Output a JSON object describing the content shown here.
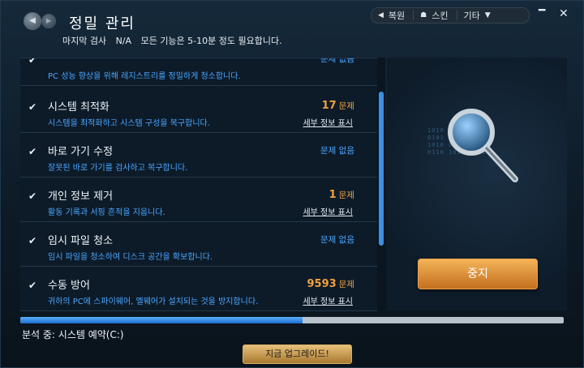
{
  "header": {
    "title": "정밀 관리",
    "last_scan_label": "마지막 검사",
    "last_scan_value": "N/A",
    "note": "모든 기능은 5-10분 정도 필요합니다."
  },
  "topbar": {
    "restore_label": "복원",
    "skin_label": "스킨",
    "etc_label": "기타"
  },
  "colors": {
    "accent_blue": "#4aa7ff",
    "issue_orange": "#f2a13c",
    "stop_button": "#e0912f"
  },
  "list": {
    "items": [
      {
        "title": "",
        "desc": "PC 성능 향상을 위해 레지스트리를 정밀하게 청소합니다.",
        "status_count": "",
        "status_text": "문제 없음",
        "detail": "",
        "checked": true
      },
      {
        "title": "시스템 최적화",
        "desc": "시스템을 최적화하고 시스템 구성을 복구합니다.",
        "status_count": "17",
        "status_text": "문제",
        "detail": "세부 정보 표시",
        "checked": true
      },
      {
        "title": "바로 가기 수정",
        "desc": "잘못된 바로 가기를 검사하고 복구합니다.",
        "status_count": "",
        "status_text": "문제 없음",
        "detail": "",
        "checked": true
      },
      {
        "title": "개인 정보 제거",
        "desc": "활동 기록과 서핑 흔적을 지웁니다.",
        "status_count": "1",
        "status_text": "문제",
        "detail": "세부 정보 표시",
        "checked": true
      },
      {
        "title": "임시 파일 청소",
        "desc": "임시 파일을 청소하여 디스크 공간을 확보합니다.",
        "status_count": "",
        "status_text": "문제 없음",
        "detail": "",
        "checked": true
      },
      {
        "title": "수동 방어",
        "desc": "귀하의 PC에 스파이웨어, 멜웨어가 설치되는 것을 방지합니다.",
        "status_count": "9593",
        "status_text": "문제",
        "detail": "세부 정보 표시",
        "checked": true
      }
    ]
  },
  "right_panel": {
    "stop_label": "중지",
    "binary_lines": [
      "1010 0101 1010",
      "0101 1010 0110",
      "1010 0101 0101",
      "0110 1010 1001"
    ]
  },
  "progress": {
    "percent": 52,
    "status_text": "분석 중: 시스템 예약(C:)"
  },
  "upgrade": {
    "label": "지금 업그레이드!"
  },
  "icons": {
    "back": "◀",
    "forward": "▶",
    "restore": "◀",
    "skin": "☗",
    "etc": "▼",
    "minimize": "━",
    "close": "✕",
    "check": "✔"
  }
}
